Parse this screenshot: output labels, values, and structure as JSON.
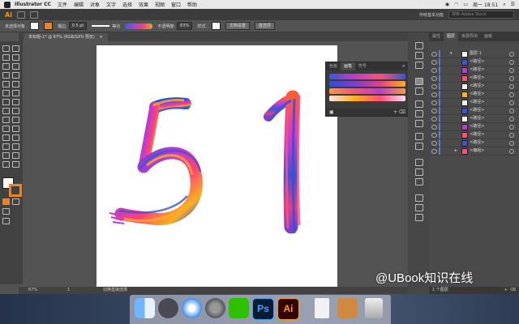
{
  "menubar": {
    "app_name": "Illustrator CC",
    "items": [
      "文件",
      "编辑",
      "对象",
      "文字",
      "选择",
      "效果",
      "视图",
      "窗口",
      "帮助"
    ],
    "clock": "周一 18:51"
  },
  "appbar": {
    "logo": "Ai",
    "workspace": "传统基本功能",
    "search_placeholder": "搜索 Adobe Stock"
  },
  "control_bar": {
    "selection_label": "未选择对象",
    "stroke_label": "描边:",
    "stroke_value": "0.5 pt",
    "uniform_label": "等比",
    "opacity_label": "不透明度:",
    "opacity_value": "63%",
    "style_label": "样式:",
    "doc_setup_button": "文档设置",
    "prefs_button": "首选项"
  },
  "document_tab": {
    "title": "未标题-1* @ 67% (RGB/GPU 预览)"
  },
  "artwork": {
    "digit_left": "5",
    "digit_right": "1"
  },
  "brush_panel": {
    "tabs": [
      "色板",
      "画笔",
      "符号"
    ],
    "active_tab": "画笔"
  },
  "status_bar": {
    "zoom": "67%",
    "page": "1",
    "tool_hint": "切换直接选择"
  },
  "layers_panel": {
    "tabs": [
      "属性",
      "图层",
      "资源导出",
      "画板"
    ],
    "active_tab": "图层",
    "layer_name": "图层 1",
    "rows": [
      "<路径>",
      "<路径>",
      "<路径>",
      "<路径>",
      "<路径>",
      "<路径>",
      "<路径>",
      "<路径>",
      "<路径>",
      "<路径>",
      "<路径>",
      "<编组>"
    ],
    "footer": "1 个图层"
  },
  "dock": {
    "apps": [
      "Finder",
      "Launchpad",
      "Safari",
      "System Preferences",
      "WeChat",
      "Photoshop",
      "Illustrator",
      "Document",
      "Preview",
      "Trash"
    ],
    "ps_label": "Ps",
    "ai_label": "Ai"
  },
  "watermark": "@UBook知识在线",
  "colors": {
    "ai_orange": "#ff9a00",
    "stroke_orange": "#e8852c",
    "panel_dark": "#424242",
    "workspace": "#535353"
  }
}
